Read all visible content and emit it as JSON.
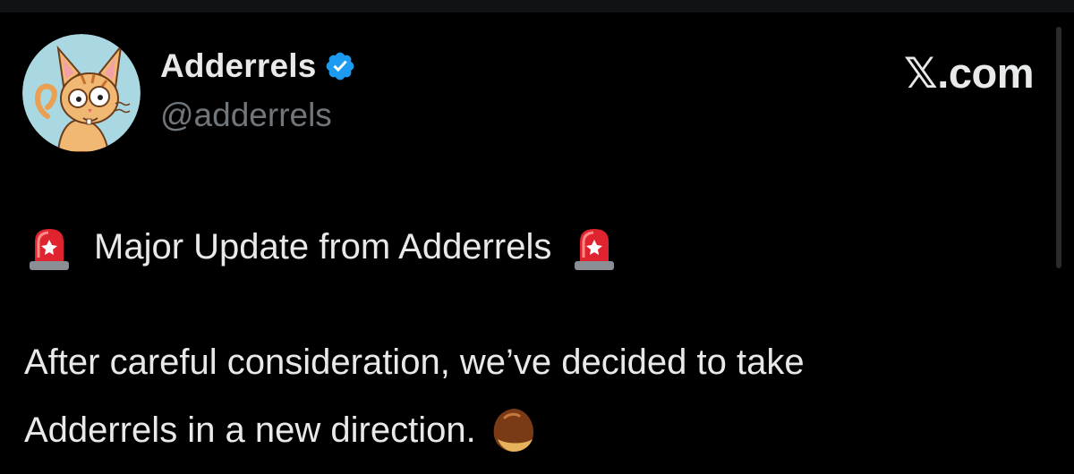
{
  "author": {
    "display_name": "Adderrels",
    "handle": "@adderrels",
    "verified": true,
    "avatar_icon": "cartoon-cat-avatar",
    "verified_icon": "verified-badge-icon",
    "verified_color": "#1d9bf0"
  },
  "brand": {
    "label": "𝕏.com"
  },
  "tweet": {
    "headline": "Major Update from Adderrels",
    "headline_left_icon": "police-light-icon",
    "headline_right_icon": "police-light-icon",
    "body_line1": "After careful consideration, we’ve decided to take",
    "body_line2": "Adderrels in a new direction.",
    "body_line2_icon": "chestnut-icon"
  },
  "colors": {
    "background": "#000000",
    "text": "#e7e9ea",
    "muted": "#71767b"
  }
}
